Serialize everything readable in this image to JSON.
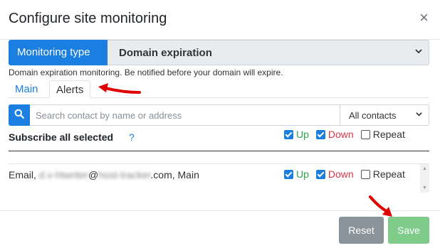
{
  "dialog": {
    "title": "Configure site monitoring",
    "close_glyph": "×"
  },
  "monitoring": {
    "label": "Monitoring type",
    "selected": "Domain expiration",
    "description": "Domain expiration monitoring. Be notified before your domain will expire."
  },
  "tabs": [
    {
      "label": "Main",
      "active": false
    },
    {
      "label": "Alerts",
      "active": true
    }
  ],
  "search": {
    "placeholder": "Search contact by name or address",
    "value": "",
    "filter_selected": "All contacts"
  },
  "subscribe": {
    "label": "Subscribe all selected",
    "help": "?",
    "up_label": "Up",
    "up_checked": true,
    "down_label": "Down",
    "down_checked": true,
    "repeat_label": "Repeat",
    "repeat_checked": false
  },
  "contacts": [
    {
      "prefix": "Email, ",
      "blurred_user": "d.v-htwriter",
      "at": "@",
      "blurred_domain": "host-tracker",
      "suffix": ".com, Main",
      "up_label": "Up",
      "up_checked": true,
      "down_label": "Down",
      "down_checked": true,
      "repeat_label": "Repeat",
      "repeat_checked": false
    }
  ],
  "buttons": {
    "reset": "Reset",
    "save": "Save"
  },
  "colors": {
    "primary": "#1a7fe0",
    "up": "#28a745",
    "down": "#dc3545",
    "reset_bg": "#8c949b",
    "save_bg": "#7fcb8a",
    "annotation_arrow": "#e00000"
  },
  "icons": {
    "close": "close-icon",
    "search": "search-icon",
    "select_chevron": "chevron-down-icon",
    "annotation": "red-arrow-icon"
  }
}
